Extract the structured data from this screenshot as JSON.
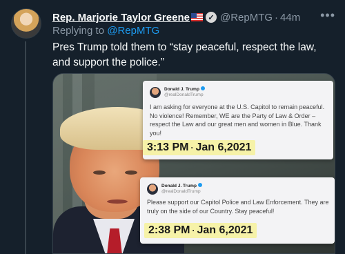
{
  "author": {
    "display_name": "Rep. Marjorie Taylor Greene",
    "handle": "@RepMTG",
    "separator": "·",
    "time": "44m"
  },
  "reply": {
    "prefix": "Replying to ",
    "handle": "@RepMTG"
  },
  "tweet": {
    "text": "Pres Trump told them to “stay peaceful, respect the law, and support the police.”"
  },
  "media": {
    "card1": {
      "name": "Donald J. Trump",
      "handle": "@realDonaldTrump",
      "text": "I am asking for everyone at the U.S. Capitol to remain peaceful. No violence! Remember, WE are the Party of Law & Order – respect the Law and our great men and women in Blue. Thank you!",
      "time": "3:13 PM",
      "dot": "·",
      "date": "Jan 6,2021"
    },
    "card2": {
      "name": "Donald J. Trump",
      "handle": "@realDonaldTrump",
      "text": "Please support our Capitol Police and Law Enforcement. They are truly on the side of our Country. Stay peaceful!",
      "time": "2:38 PM",
      "dot": "·",
      "date": "Jan 6,2021"
    }
  },
  "icons": {
    "more": "more-icon",
    "verified": "verified-icon",
    "flag": "us-flag-icon"
  },
  "colors": {
    "background": "#15202b",
    "link": "#1d9bf0",
    "muted": "#8b98a5",
    "highlight": "#f6f2a8"
  }
}
